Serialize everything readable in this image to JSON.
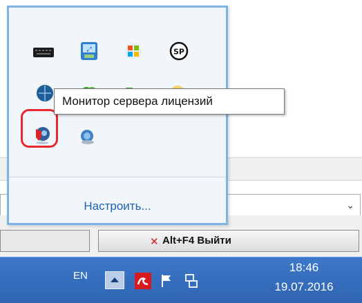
{
  "flyout": {
    "icons_row1": [
      "keyboard-app-icon",
      "network-monitor-app-icon",
      "windows-update-icon",
      "sp-app-icon"
    ],
    "icons_row2": [
      "globe-app-icon",
      "green-app-icon",
      "folder-sync-icon",
      "lock-app-icon"
    ],
    "icons_row3": [
      "license-server-monitor-icon",
      "globe-gear-icon"
    ],
    "customize_label": "Настроить..."
  },
  "tooltip": {
    "text": "Монитор сервера лицензий"
  },
  "background": {
    "exit_button_label": "Alt+F4 Выйти"
  },
  "taskbar": {
    "language": "EN",
    "time": "18:46",
    "date": "19.07.2016"
  },
  "colors": {
    "taskbar": "#3a74c2",
    "flyout_bg": "#f1f6fb",
    "flyout_border": "#7fb2e6",
    "highlight_ring": "#e8262b",
    "link": "#1f5fb0"
  }
}
